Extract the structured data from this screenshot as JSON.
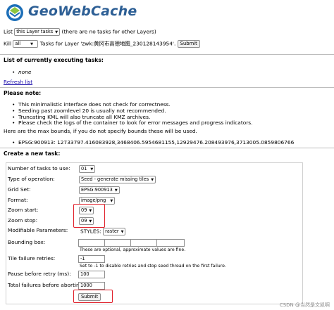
{
  "brand": {
    "name": "GeoWebCache",
    "accent": "#2d5f95",
    "logo_icon": "geowebcache-logo-icon"
  },
  "list_row": {
    "label": "List",
    "select_value": "this Layer tasks",
    "note": "(there are no tasks for other Layers)"
  },
  "kill_row": {
    "label": "Kill",
    "select_value": "all",
    "text": "Tasks for Layer 'zwk:黄冈市高德地图_230128143954'.",
    "button": "Submit"
  },
  "executing": {
    "heading": "List of currently executing tasks:",
    "items": [
      "none"
    ],
    "refresh_link": "Refresh list"
  },
  "notes": {
    "heading": "Please note:",
    "items": [
      "This minimalistic interface does not check for correctness.",
      "Seeding past zoomlevel 20 is usually not recommended.",
      "Truncating KML will also truncate all KMZ archives.",
      "Please check the logs of the container to look for error messages and progress indicators."
    ]
  },
  "bounds": {
    "intro": "Here are the max bounds, if you do not specify bounds these will be used.",
    "items": [
      "EPSG:900913: 12733797.416083928,3468406.5954681155,12929476.208493976,3713005.0859806766"
    ]
  },
  "create": {
    "heading": "Create a new task:",
    "number_of_tasks": {
      "label": "Number of tasks to use:",
      "value": "01"
    },
    "type": {
      "label": "Type of operation:",
      "value": "Seed - generate missing tiles"
    },
    "gridset": {
      "label": "Grid Set:",
      "value": "EPSG:900913"
    },
    "format": {
      "label": "Format:",
      "value": "image/png"
    },
    "zoom_start": {
      "label": "Zoom start:",
      "value": "09"
    },
    "zoom_stop": {
      "label": "Zoom stop:",
      "value": "09"
    },
    "params": {
      "label": "Modifiable Parameters:",
      "name": "STYLES:",
      "value": "raster"
    },
    "bbox": {
      "label": "Bounding box:",
      "values": [
        "",
        "",
        "",
        ""
      ],
      "note": "These are optional, approximate values are fine."
    },
    "retries": {
      "label": "Tile failure retries:",
      "value": "-1",
      "note": "Set to -1 to disable retries and stop seed thread on the first failure."
    },
    "pause": {
      "label": "Pause before retry (ms):",
      "value": "100"
    },
    "total": {
      "label": "Total failures before aborting:",
      "value": "1000"
    },
    "submit": "Submit"
  },
  "highlight_color": "#e0202a",
  "watermark": "CSDN @当然是文凯啊"
}
